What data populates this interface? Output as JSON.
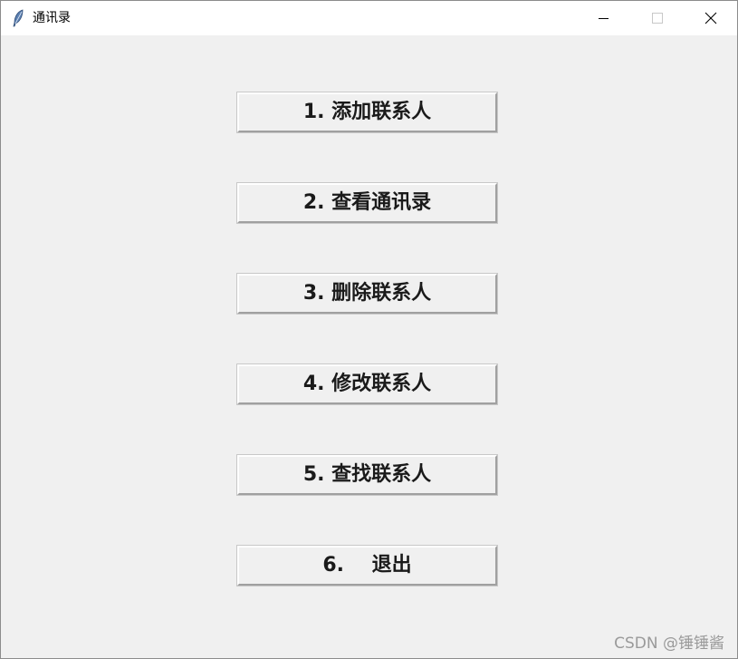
{
  "window": {
    "title": "通讯录",
    "icon": "feather-icon"
  },
  "buttons": [
    {
      "label": "1. 添加联系人"
    },
    {
      "label": "2. 查看通讯录"
    },
    {
      "label": "3. 删除联系人"
    },
    {
      "label": "4. 修改联系人"
    },
    {
      "label": "5. 查找联系人"
    },
    {
      "label": "6.    退出"
    }
  ],
  "watermark": "CSDN @锤锤酱"
}
